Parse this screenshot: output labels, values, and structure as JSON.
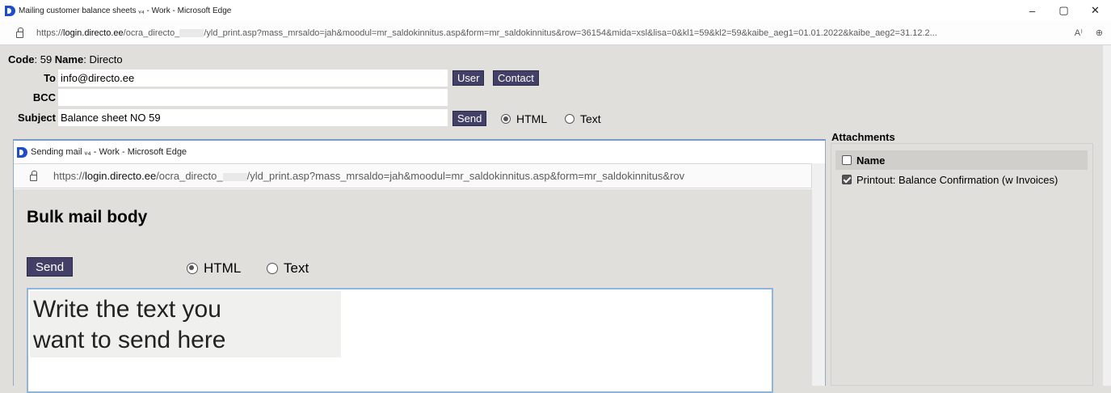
{
  "browser": {
    "window_title": "Mailing customer balance sheets ᵥ₄ - Work - Microsoft Edge",
    "url_prefix": "https://",
    "url_domain": "login.directo.ee",
    "url_path_a": "/ocra_directo_",
    "url_path_b": "/yld_print.asp?mass_mrsaldo=jah&moodul=mr_saldokinnitus.asp&form=mr_saldokinnitus&row=36154&mida=xsl&lisa=0&kl1=59&kl2=59&kaibe_aeg1=01.01.2022&kaibe_aeg2=31.12.2...",
    "controls": {
      "minimize": "–",
      "maximize": "▢",
      "close": "✕"
    },
    "read_aloud": "A⁾",
    "zoom": "⊕"
  },
  "page": {
    "code_label": "Code",
    "code_value": ": 59 ",
    "name_label": "Name",
    "name_value": ": Directo",
    "to_label": "To",
    "to_value": "info@directo.ee",
    "bcc_label": "BCC",
    "bcc_value": "",
    "subject_label": "Subject",
    "subject_value": "Balance sheet NO 59",
    "user_btn": "User",
    "contact_btn": "Contact",
    "send_btn": "Send",
    "html_label": "HTML",
    "text_label": "Text"
  },
  "attachments": {
    "title": "Attachments",
    "header": "Name",
    "items": [
      {
        "label": "Printout: Balance Confirmation (w Invoices)",
        "checked": true
      }
    ]
  },
  "popup": {
    "window_title": "Sending mail ᵥ₄ - Work - Microsoft Edge",
    "url_prefix": "https://",
    "url_domain": "login.directo.ee",
    "url_path_a": "/ocra_directo_",
    "url_path_b": "/yld_print.asp?mass_mrsaldo=jah&moodul=mr_saldokinnitus.asp&form=mr_saldokinnitus&rov",
    "heading": "Bulk mail body",
    "send_btn": "Send",
    "html_label": "HTML",
    "text_label": "Text",
    "editor_text_line1": "Write the text you",
    "editor_text_line2": "want to send here"
  }
}
